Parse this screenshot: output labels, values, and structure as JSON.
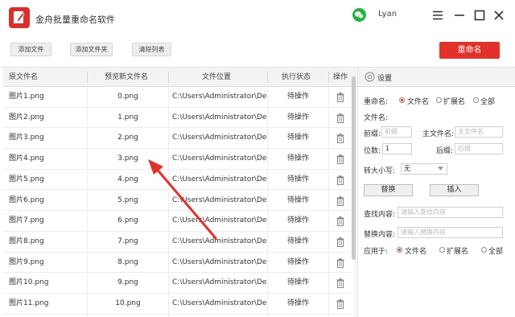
{
  "app": {
    "title": "金舟批量重命名软件",
    "username": "Lyan"
  },
  "colors": {
    "accent": "#e1312a",
    "wechat": "#27b245"
  },
  "toolbar": {
    "add_file": "添加文件",
    "add_folder": "添加文件夹",
    "clear_list": "清除列表",
    "rename": "重命名"
  },
  "table": {
    "headers": [
      "原文件名",
      "预览新文件名",
      "文件位置",
      "执行状态",
      "操作"
    ],
    "rows": [
      {
        "orig": "图片1.png",
        "preview": "0.png",
        "location": "C:\\Users\\Administrator\\De...",
        "status": "待操作"
      },
      {
        "orig": "图片2.png",
        "preview": "1.png",
        "location": "C:\\Users\\Administrator\\De...",
        "status": "待操作"
      },
      {
        "orig": "图片3.png",
        "preview": "2.png",
        "location": "C:\\Users\\Administrator\\De...",
        "status": "待操作"
      },
      {
        "orig": "图片4.png",
        "preview": "3.png",
        "location": "C:\\Users\\Administrator\\De...",
        "status": "待操作"
      },
      {
        "orig": "图片5.png",
        "preview": "4.png",
        "location": "C:\\Users\\Administrator\\De...",
        "status": "待操作"
      },
      {
        "orig": "图片6.png",
        "preview": "5.png",
        "location": "C:\\Users\\Administrator\\De...",
        "status": "待操作"
      },
      {
        "orig": "图片7.png",
        "preview": "6.png",
        "location": "C:\\Users\\Administrator\\De...",
        "status": "待操作"
      },
      {
        "orig": "图片8.png",
        "preview": "7.png",
        "location": "C:\\Users\\Administrator\\De...",
        "status": "待操作"
      },
      {
        "orig": "图片9.png",
        "preview": "8.png",
        "location": "C:\\Users\\Administrator\\De...",
        "status": "待操作"
      },
      {
        "orig": "图片10.png",
        "preview": "9.png",
        "location": "C:\\Users\\Administrator\\De...",
        "status": "待操作"
      },
      {
        "orig": "图片11.png",
        "preview": "10.png",
        "location": "C:\\Users\\Administrator\\De...",
        "status": "待操作"
      }
    ]
  },
  "settings": {
    "title": "设置",
    "rename_label": "重命名:",
    "rename_options": [
      "文件名",
      "扩展名",
      "全部"
    ],
    "filename_label": "文件名:",
    "prefix_label": "前缀:",
    "prefix_placeholder": "前缀",
    "main_name_label": "主文件名:",
    "main_name_placeholder": "主文件名",
    "digits_label": "位数:",
    "digits_value": "1",
    "suffix_label": "后缀:",
    "suffix_placeholder": "后缀",
    "case_label": "转大小写:",
    "case_value": "无",
    "replace_button": "替换",
    "insert_button": "插入",
    "find_label": "查找内容:",
    "find_placeholder": "请输入查找内容",
    "replace_label": "替换内容:",
    "replace_placeholder": "请输入替换内容",
    "apply_label": "应用于:",
    "apply_options": [
      "文件名",
      "扩展名",
      "全部"
    ]
  }
}
